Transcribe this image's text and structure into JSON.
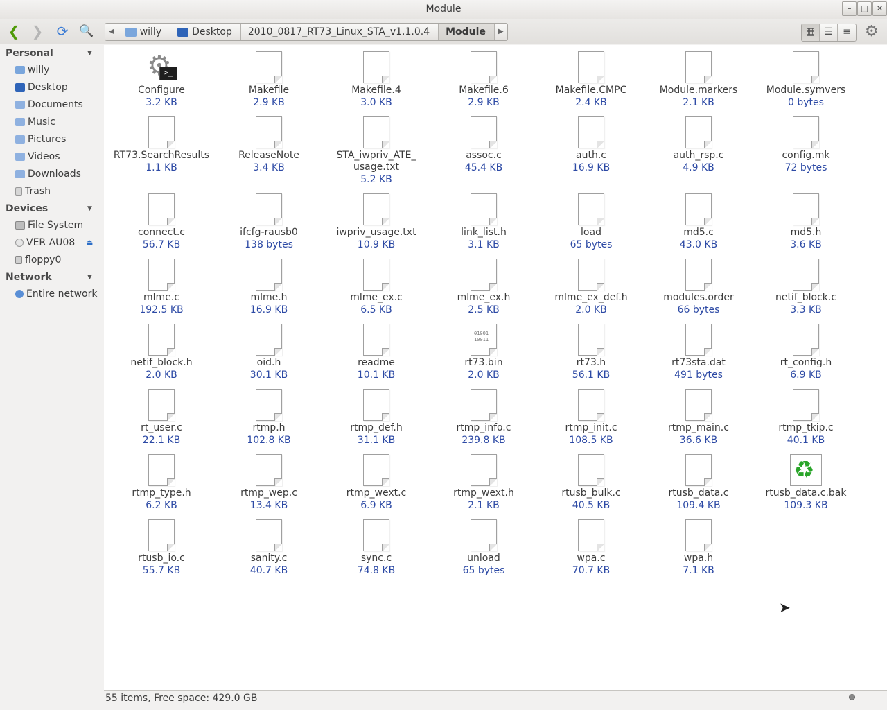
{
  "window": {
    "title": "Module"
  },
  "toolbar": {
    "back": "❮",
    "forward": "❯",
    "reload": "⟳",
    "search": "🔍",
    "path": [
      "willy",
      "Desktop",
      "2010_0817_RT73_Linux_STA_v1.1.0.4",
      "Module"
    ],
    "path_left_arrow": "◀",
    "path_right_arrow": "▶",
    "view_icons": "▦",
    "view_compact": "☰",
    "view_list": "≡",
    "gear": "⚙"
  },
  "sidebar": {
    "personal": {
      "label": "Personal",
      "items": [
        "willy",
        "Desktop",
        "Documents",
        "Music",
        "Pictures",
        "Videos",
        "Downloads",
        "Trash"
      ]
    },
    "devices": {
      "label": "Devices",
      "items": [
        "File System",
        "VER AU08",
        "floppy0"
      ]
    },
    "network": {
      "label": "Network",
      "items": [
        "Entire network"
      ]
    },
    "collapse": "▼",
    "eject": "⏏"
  },
  "files": [
    {
      "name": "Configure",
      "size": "3.2 KB",
      "icon": "script-icon"
    },
    {
      "name": "Makefile",
      "size": "2.9 KB",
      "icon": "document-icon"
    },
    {
      "name": "Makefile.4",
      "size": "3.0 KB",
      "icon": "document-icon"
    },
    {
      "name": "Makefile.6",
      "size": "2.9 KB",
      "icon": "document-icon"
    },
    {
      "name": "Makefile.CMPC",
      "size": "2.4 KB",
      "icon": "document-icon"
    },
    {
      "name": "Module.markers",
      "size": "2.1 KB",
      "icon": "document-icon"
    },
    {
      "name": "Module.symvers",
      "size": "0 bytes",
      "icon": "document-icon"
    },
    {
      "name": "RT73.SearchResults",
      "size": "1.1 KB",
      "icon": "document-icon"
    },
    {
      "name": "ReleaseNote",
      "size": "3.4 KB",
      "icon": "document-icon"
    },
    {
      "name": "STA_iwpriv_ATE_usage.txt",
      "size": "5.2 KB",
      "icon": "document-icon"
    },
    {
      "name": "assoc.c",
      "size": "45.4 KB",
      "icon": "document-icon"
    },
    {
      "name": "auth.c",
      "size": "16.9 KB",
      "icon": "document-icon"
    },
    {
      "name": "auth_rsp.c",
      "size": "4.9 KB",
      "icon": "document-icon"
    },
    {
      "name": "config.mk",
      "size": "72 bytes",
      "icon": "document-icon"
    },
    {
      "name": "connect.c",
      "size": "56.7 KB",
      "icon": "document-icon"
    },
    {
      "name": "ifcfg-rausb0",
      "size": "138 bytes",
      "icon": "document-icon"
    },
    {
      "name": "iwpriv_usage.txt",
      "size": "10.9 KB",
      "icon": "document-icon"
    },
    {
      "name": "link_list.h",
      "size": "3.1 KB",
      "icon": "document-icon"
    },
    {
      "name": "load",
      "size": "65 bytes",
      "icon": "document-icon"
    },
    {
      "name": "md5.c",
      "size": "43.0 KB",
      "icon": "document-icon"
    },
    {
      "name": "md5.h",
      "size": "3.6 KB",
      "icon": "document-icon"
    },
    {
      "name": "mlme.c",
      "size": "192.5 KB",
      "icon": "document-icon"
    },
    {
      "name": "mlme.h",
      "size": "16.9 KB",
      "icon": "document-icon"
    },
    {
      "name": "mlme_ex.c",
      "size": "6.5 KB",
      "icon": "document-icon"
    },
    {
      "name": "mlme_ex.h",
      "size": "2.5 KB",
      "icon": "document-icon"
    },
    {
      "name": "mlme_ex_def.h",
      "size": "2.0 KB",
      "icon": "document-icon"
    },
    {
      "name": "modules.order",
      "size": "66 bytes",
      "icon": "document-icon"
    },
    {
      "name": "netif_block.c",
      "size": "3.3 KB",
      "icon": "document-icon"
    },
    {
      "name": "netif_block.h",
      "size": "2.0 KB",
      "icon": "document-icon"
    },
    {
      "name": "oid.h",
      "size": "30.1 KB",
      "icon": "document-icon"
    },
    {
      "name": "readme",
      "size": "10.1 KB",
      "icon": "document-icon"
    },
    {
      "name": "rt73.bin",
      "size": "2.0 KB",
      "icon": "binary-icon"
    },
    {
      "name": "rt73.h",
      "size": "56.1 KB",
      "icon": "document-icon"
    },
    {
      "name": "rt73sta.dat",
      "size": "491 bytes",
      "icon": "document-icon"
    },
    {
      "name": "rt_config.h",
      "size": "6.9 KB",
      "icon": "document-icon"
    },
    {
      "name": "rt_user.c",
      "size": "22.1 KB",
      "icon": "document-icon"
    },
    {
      "name": "rtmp.h",
      "size": "102.8 KB",
      "icon": "document-icon"
    },
    {
      "name": "rtmp_def.h",
      "size": "31.1 KB",
      "icon": "document-icon"
    },
    {
      "name": "rtmp_info.c",
      "size": "239.8 KB",
      "icon": "document-icon"
    },
    {
      "name": "rtmp_init.c",
      "size": "108.5 KB",
      "icon": "document-icon"
    },
    {
      "name": "rtmp_main.c",
      "size": "36.6 KB",
      "icon": "document-icon"
    },
    {
      "name": "rtmp_tkip.c",
      "size": "40.1 KB",
      "icon": "document-icon"
    },
    {
      "name": "rtmp_type.h",
      "size": "6.2 KB",
      "icon": "document-icon"
    },
    {
      "name": "rtmp_wep.c",
      "size": "13.4 KB",
      "icon": "document-icon"
    },
    {
      "name": "rtmp_wext.c",
      "size": "6.9 KB",
      "icon": "document-icon"
    },
    {
      "name": "rtmp_wext.h",
      "size": "2.1 KB",
      "icon": "document-icon"
    },
    {
      "name": "rtusb_bulk.c",
      "size": "40.5 KB",
      "icon": "document-icon"
    },
    {
      "name": "rtusb_data.c",
      "size": "109.4 KB",
      "icon": "document-icon"
    },
    {
      "name": "rtusb_data.c.bak",
      "size": "109.3 KB",
      "icon": "recycle-icon"
    },
    {
      "name": "rtusb_io.c",
      "size": "55.7 KB",
      "icon": "document-icon"
    },
    {
      "name": "sanity.c",
      "size": "40.7 KB",
      "icon": "document-icon"
    },
    {
      "name": "sync.c",
      "size": "74.8 KB",
      "icon": "document-icon"
    },
    {
      "name": "unload",
      "size": "65 bytes",
      "icon": "document-icon"
    },
    {
      "name": "wpa.c",
      "size": "70.7 KB",
      "icon": "document-icon"
    },
    {
      "name": "wpa.h",
      "size": "7.1 KB",
      "icon": "document-icon"
    }
  ],
  "status": {
    "text": "55 items, Free space: 429.0 GB"
  },
  "colors": {
    "size_text": "#2d4aa5",
    "folder_blue": "#3a7bd5",
    "nav_green": "#4e9a06"
  }
}
